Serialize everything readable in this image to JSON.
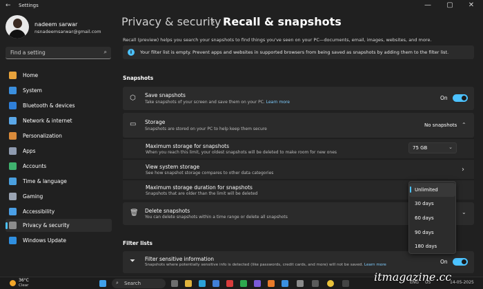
{
  "window": {
    "title": "Settings",
    "back_icon": "back-arrow-icon",
    "controls": [
      "—",
      "▢",
      "✕"
    ]
  },
  "user": {
    "name": "nadeem sarwar",
    "email": "nsnadeemsarwar@gmail.com"
  },
  "search": {
    "placeholder": "Find a setting"
  },
  "sidebar": {
    "items": [
      {
        "label": "Home",
        "icon": "home-icon",
        "color": "#e8a33c"
      },
      {
        "label": "System",
        "icon": "system-icon",
        "color": "#3b8fde"
      },
      {
        "label": "Bluetooth & devices",
        "icon": "bluetooth-icon",
        "color": "#2f7fd8"
      },
      {
        "label": "Network & internet",
        "icon": "wifi-icon",
        "color": "#5aa7e8"
      },
      {
        "label": "Personalization",
        "icon": "brush-icon",
        "color": "#d98a3a"
      },
      {
        "label": "Apps",
        "icon": "apps-icon",
        "color": "#8f9bb0"
      },
      {
        "label": "Accounts",
        "icon": "account-icon",
        "color": "#3fb26e"
      },
      {
        "label": "Time & language",
        "icon": "globe-clock-icon",
        "color": "#4aa0e0"
      },
      {
        "label": "Gaming",
        "icon": "gamepad-icon",
        "color": "#9aa4b3"
      },
      {
        "label": "Accessibility",
        "icon": "accessibility-icon",
        "color": "#4a9fe6"
      },
      {
        "label": "Privacy & security",
        "icon": "shield-icon",
        "color": "#8c8c8c",
        "active": true
      },
      {
        "label": "Windows Update",
        "icon": "update-icon",
        "color": "#2f8fe0"
      }
    ]
  },
  "breadcrumb": {
    "parent": "Privacy & security",
    "separator": "›",
    "current": "Recall & snapshots"
  },
  "intro": "Recall (preview) helps you search your snapshots to find things you've seen on your PC—documents, email, images, websites, and more.",
  "info_bar": {
    "icon": "i",
    "text": "Your filter list is empty. Prevent apps and websites in supported browsers from being saved as snapshots by adding them to the filter list."
  },
  "snapshots": {
    "heading": "Snapshots",
    "save": {
      "title": "Save snapshots",
      "desc": "Take snapshots of your screen and save them on your PC.",
      "link": "Learn more",
      "state": "On"
    },
    "storage": {
      "title": "Storage",
      "desc": "Snapshots are stored on your PC to help keep them secure",
      "value": "No snapshots"
    },
    "max_storage": {
      "title": "Maximum storage for snapshots",
      "desc": "When you reach this limit, your oldest snapshots will be deleted to make room for new ones",
      "value": "75 GB"
    },
    "system_storage": {
      "title": "View system storage",
      "desc": "See how snapshot storage compares to other data categories"
    },
    "max_duration": {
      "title": "Maximum storage duration for snapshots",
      "desc": "Snapshots that are older than the limit will be deleted",
      "options": [
        "Unlimited",
        "30 days",
        "60 days",
        "90 days",
        "180 days"
      ],
      "selected": "Unlimited"
    },
    "delete": {
      "title": "Delete snapshots",
      "desc": "You can delete snapshots within a time range or delete all snapshots"
    }
  },
  "filters": {
    "heading": "Filter lists",
    "sensitive": {
      "title": "Filter sensitive information",
      "desc": "Snapshots where potentially sensitive info is detected (like passwords, credit cards, and more) will not be saved.",
      "link": "Learn more",
      "state": "On"
    }
  },
  "taskbar": {
    "temp": "36°C",
    "weather": "Clear",
    "search": "Search",
    "lang": "ENG",
    "region": "US",
    "date": "14-05-2025"
  },
  "watermark": "itmagazine.cc"
}
